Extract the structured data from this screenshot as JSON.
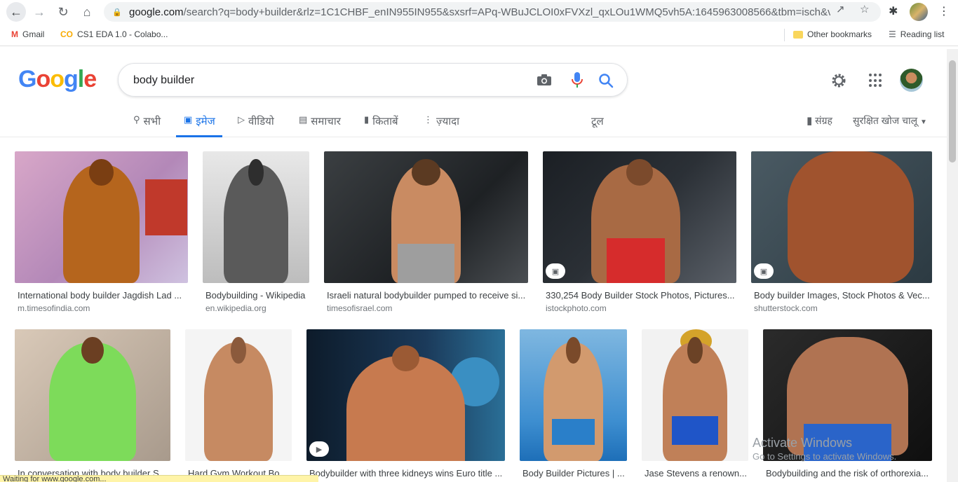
{
  "browser": {
    "url_domain": "google.com",
    "url_rest": "/search?q=body+builder&rlz=1C1CHBF_enIN955IN955&sxsrf=APq-WBuJCLOI0xFVXzl_qxLOu1WMQ5vh5A:1645963008566&tbm=isch&ved...",
    "bookmarks": [
      {
        "label": "Gmail"
      },
      {
        "label": "CS1 EDA 1.0 - Colabo..."
      }
    ],
    "other_bookmarks": "Other bookmarks",
    "reading_list": "Reading list"
  },
  "search": {
    "logo": [
      "G",
      "o",
      "o",
      "g",
      "l",
      "e"
    ],
    "query": "body builder"
  },
  "tabs": [
    {
      "label": "सभी",
      "icon": "search-icon"
    },
    {
      "label": "इमेज",
      "icon": "image-icon",
      "active": true
    },
    {
      "label": "वीडियो",
      "icon": "video-icon"
    },
    {
      "label": "समाचार",
      "icon": "news-icon"
    },
    {
      "label": "किताबें",
      "icon": "book-icon"
    },
    {
      "label": "ज़्यादा",
      "icon": "more-vert-icon"
    }
  ],
  "tools_label": "टूल",
  "collections_label": "संग्रह",
  "safesearch_label": "सुरक्षित खोज चालू",
  "results_row1": [
    {
      "title": "International body builder Jagdish Lad ...",
      "source": "m.timesofindia.com"
    },
    {
      "title": "Bodybuilding - Wikipedia",
      "source": "en.wikipedia.org"
    },
    {
      "title": "Israeli natural bodybuilder pumped to receive si...",
      "source": "timesofisrael.com"
    },
    {
      "title": "330,254 Body Builder Stock Photos, Pictures...",
      "source": "istockphoto.com"
    },
    {
      "title": "Body builder Images, Stock Photos & Vec...",
      "source": "shutterstock.com"
    }
  ],
  "results_row2": [
    {
      "title": "In conversation with body builder S..."
    },
    {
      "title": "Hard Gym Workout Bo..."
    },
    {
      "title": "Bodybuilder with three kidneys wins Euro title ..."
    },
    {
      "title": "Body Builder Pictures | ..."
    },
    {
      "title": "Jase Stevens a renown..."
    },
    {
      "title": "Bodybuilding and the risk of orthorexia..."
    }
  ],
  "status_text": "Waiting for www.google.com...",
  "watermark": {
    "line1": "Activate Windows",
    "line2": "Go to Settings to activate Windows."
  },
  "colors": {
    "accent": "#1a73e8",
    "google_blue": "#4285f4",
    "google_red": "#ea4335",
    "google_yellow": "#fbbc05",
    "google_green": "#34a853"
  }
}
